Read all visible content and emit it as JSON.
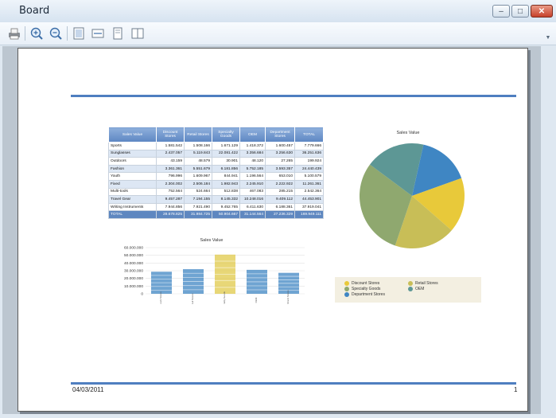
{
  "window": {
    "title": "Board",
    "min": "–",
    "max": "□",
    "close": "✕"
  },
  "toolbar": {
    "buttons": [
      "print-icon",
      "zoom-in-icon",
      "zoom-out-icon",
      "fit-page-icon",
      "fit-width-icon",
      "one-page-icon",
      "two-page-icon"
    ]
  },
  "report": {
    "footer_date": "04/03/2011",
    "page_number": "1",
    "table": {
      "headers": [
        "Sales Value",
        "Discount Stores",
        "Retail Stores",
        "Specialty Goods",
        "OEM",
        "Department Stores",
        "TOTAL"
      ],
      "rows": [
        [
          "Sports",
          "1.581.542",
          "1.508.166",
          "1.671.129",
          "1.418.372",
          "1.600.457",
          "7.779.666"
        ],
        [
          "Sunglasses",
          "2.437.057",
          "5.119.843",
          "22.081.422",
          "3.356.684",
          "3.256.630",
          "36.251.636"
        ],
        [
          "Outdoors",
          "43.159",
          "48.579",
          "30.901",
          "48.120",
          "27.265",
          "199.924"
        ],
        [
          "Fashion",
          "3.361.361",
          "5.551.679",
          "6.181.856",
          "5.752.185",
          "3.593.357",
          "24.440.439"
        ],
        [
          "Youth",
          "796.996",
          "1.609.967",
          "844.941",
          "1.196.564",
          "653.010",
          "5.100.579"
        ],
        [
          "Fixed",
          "2.304.002",
          "2.506.184",
          "1.982.943",
          "2.245.910",
          "2.222.922",
          "11.261.361"
        ],
        [
          "Multi-tools",
          "752.564",
          "524.664",
          "512.838",
          "467.083",
          "285.215",
          "2.542.364"
        ],
        [
          "Travel Gear",
          "9.457.287",
          "7.194.155",
          "8.145.332",
          "10.248.016",
          "9.409.112",
          "44.453.901"
        ],
        [
          "Writing Instruments",
          "7.944.856",
          "7.921.490",
          "9.452.765",
          "6.411.630",
          "6.188.361",
          "37.919.041"
        ],
        [
          "TOTAL",
          "28.678.825",
          "31.984.725",
          "50.904.667",
          "31.144.564",
          "27.236.329",
          "169.949.111"
        ]
      ]
    },
    "legend": [
      "Discount Stores",
      "Retail Stores",
      "Specialty Goods",
      "OEM",
      "Department Stores"
    ]
  },
  "colors": {
    "accent_rule": "#4f7fc0",
    "discount_stores": "#e8c93a",
    "retail_stores": "#c8be57",
    "specialty_goods": "#8fa86f",
    "oem": "#5d9795",
    "department_stores": "#3f86c3"
  },
  "chart_data": [
    {
      "type": "bar",
      "title": "Sales Value",
      "categories": [
        "Discount Stores",
        "Retail Stores",
        "Specialty Goods",
        "OEM",
        "Department Stores"
      ],
      "values": [
        28678825,
        31984725,
        50904667,
        31144564,
        27236329
      ],
      "yticks": [
        "0",
        "10.000.000",
        "20.000.000",
        "30.000.000",
        "40.000.000",
        "50.000.000",
        "60.000.000"
      ],
      "ylim": [
        0,
        60000000
      ],
      "grid": true
    },
    {
      "type": "pie",
      "title": "Sales Value",
      "categories": [
        "Department Stores",
        "Discount Stores",
        "Retail Stores",
        "Specialty Goods",
        "OEM"
      ],
      "values": [
        27236329,
        28678825,
        31984725,
        50904667,
        31144564
      ]
    }
  ]
}
